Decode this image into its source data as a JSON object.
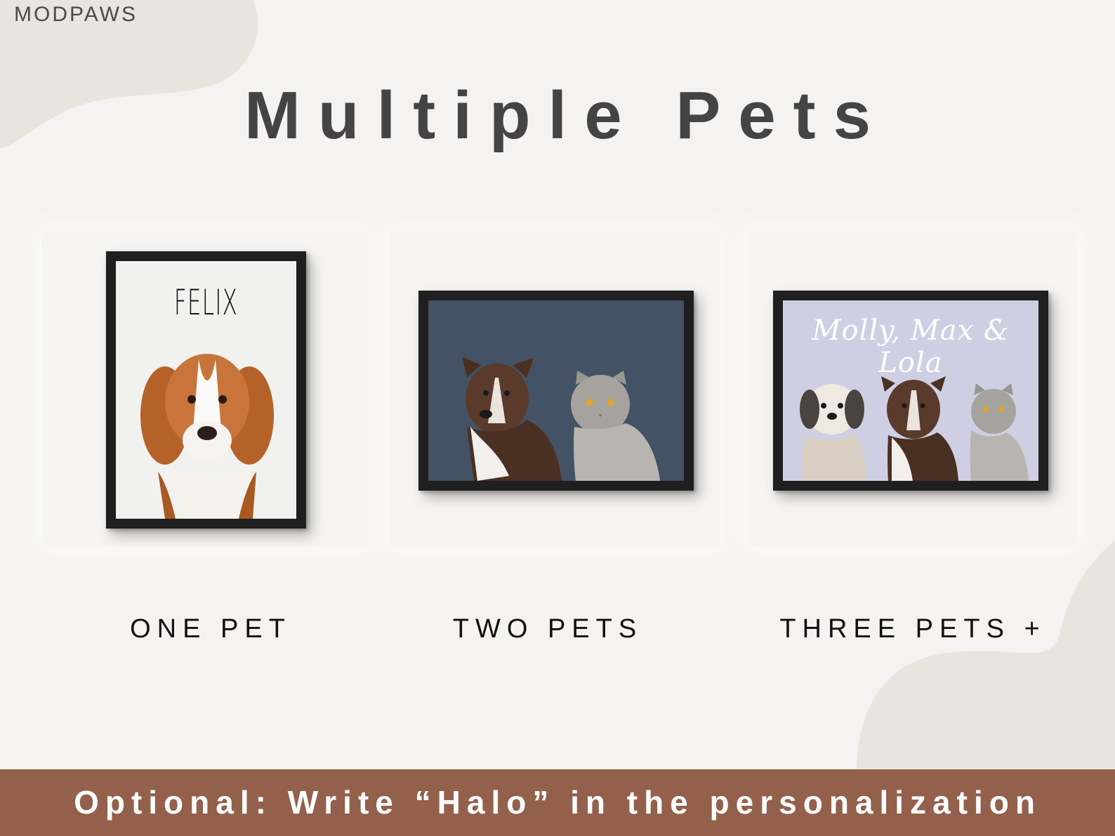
{
  "brand": "MODPAWS",
  "title": "Multiple Pets",
  "options": [
    {
      "caption": "ONE PET",
      "portrait_name": "FELIX",
      "background": "#f1f1f0"
    },
    {
      "caption": "TWO PETS",
      "portrait_name": "",
      "background": "#435264"
    },
    {
      "caption": "THREE PETS +",
      "portrait_name": "Molly, Max & Lola",
      "background": "#cfcfe3"
    }
  ],
  "footer": "Optional: Write “Halo” in the personalization"
}
